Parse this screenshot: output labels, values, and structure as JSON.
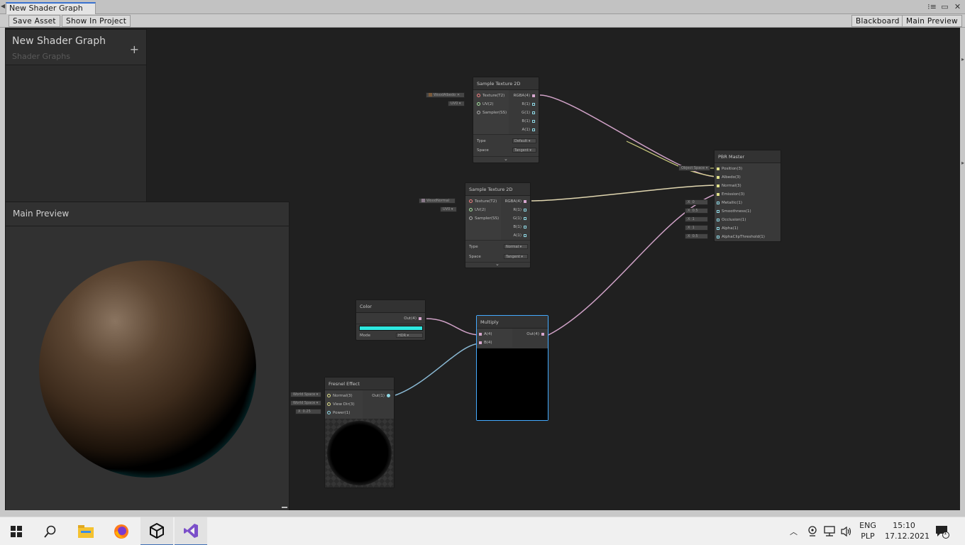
{
  "window": {
    "tab_title": "New Shader Graph",
    "controls": [
      "⁝≡",
      "▭",
      "✕"
    ]
  },
  "toolbar": {
    "save_asset": "Save Asset",
    "show_in_project": "Show In Project",
    "blackboard": "Blackboard",
    "main_preview": "Main Preview"
  },
  "blackboard": {
    "title": "New Shader Graph",
    "subtitle": "Shader Graphs",
    "add": "+"
  },
  "main_preview": {
    "title": "Main Preview"
  },
  "nodes": {
    "sample1": {
      "title": "Sample Texture 2D",
      "in_texture_value": "WoodAlbedo",
      "in_uv_value": "UV0",
      "inputs": [
        "Texture(T2)",
        "UV(2)",
        "Sampler(SS)"
      ],
      "outputs": [
        "RGBA(4)",
        "R(1)",
        "G(1)",
        "B(1)",
        "A(1)"
      ],
      "type_label": "Type",
      "type_value": "Default",
      "space_label": "Space",
      "space_value": "Tangent"
    },
    "sample2": {
      "title": "Sample Texture 2D",
      "in_texture_value": "WoodNormal",
      "in_uv_value": "UV0",
      "inputs": [
        "Texture(T2)",
        "UV(2)",
        "Sampler(SS)"
      ],
      "outputs": [
        "RGBA(4)",
        "R(1)",
        "G(1)",
        "B(1)",
        "A(1)"
      ],
      "type_label": "Type",
      "type_value": "Normal",
      "space_label": "Space",
      "space_value": "Tangent"
    },
    "pbr": {
      "title": "PBR Master",
      "position_space": "Object Space",
      "inputs": [
        "Position(3)",
        "Albedo(3)",
        "Normal(3)",
        "Emission(3)",
        "Metallic(1)",
        "Smoothness(1)",
        "Occlusion(1)",
        "Alpha(1)",
        "AlphaClipThreshold(1)"
      ],
      "metallic": "0",
      "smoothness": "0.5",
      "occlusion": "1",
      "alpha": "1",
      "alpha_clip": "0.5",
      "x_label": "X"
    },
    "color": {
      "title": "Color",
      "output": "Out(4)",
      "mode_label": "Mode",
      "mode_value": "HDR",
      "swatch": "#2ee8e0"
    },
    "multiply": {
      "title": "Multiply",
      "inputs": [
        "A(4)",
        "B(4)"
      ],
      "output": "Out(4)"
    },
    "fresnel": {
      "title": "Fresnel Effect",
      "inputs": [
        "Normal(3)",
        "View Dir(3)",
        "Power(1)"
      ],
      "output": "Out(1)",
      "normal_space": "World Space",
      "viewdir_space": "World Space",
      "power_value": "0.25",
      "x_label": "X"
    }
  },
  "taskbar": {
    "lang": "ENG",
    "layout": "PLP",
    "time": "15:10",
    "date": "17.12.2021",
    "notifications": "1"
  },
  "colors": {
    "canvas": "#202020",
    "edge_vec4": "#d0a0c8",
    "edge_vec3": "#e0e08a",
    "edge_vec1": "#88c8e0",
    "selected": "#44aaff",
    "fresnel_glow": "#00ffff"
  }
}
